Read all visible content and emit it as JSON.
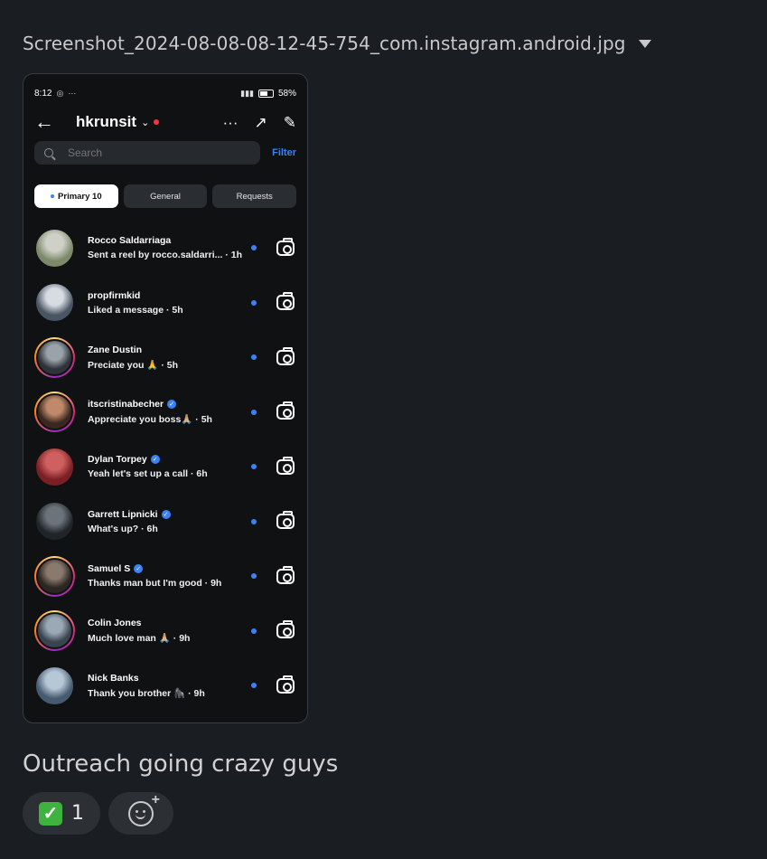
{
  "file": {
    "name": "Screenshot_2024-08-08-08-12-45-754_com.instagram.android.jpg"
  },
  "phone": {
    "status": {
      "time": "8:12",
      "dots": "···",
      "battery": "58%"
    },
    "header": {
      "username": "hkrunsit",
      "more": "···"
    },
    "search": {
      "placeholder": "Search",
      "filter_label": "Filter"
    },
    "tabs": [
      {
        "label": "Primary 10",
        "active": true
      },
      {
        "label": "General",
        "active": false
      },
      {
        "label": "Requests",
        "active": false
      }
    ],
    "threads": [
      {
        "name": "Rocco Saldarriaga",
        "verified": false,
        "message": "Sent a reel by rocco.saldarri...",
        "time": "1h",
        "ring": false,
        "avatar_colors": [
          "#cfd1c8",
          "#7d8a6a"
        ]
      },
      {
        "name": "propfirmkid",
        "verified": false,
        "message": "Liked a message",
        "time": "5h",
        "ring": false,
        "avatar_colors": [
          "#d7dbe2",
          "#4a5563"
        ]
      },
      {
        "name": "Zane Dustin",
        "verified": false,
        "message": "Preciate you 🙏",
        "time": "5h",
        "ring": true,
        "avatar_colors": [
          "#9aa2aa",
          "#2d3338"
        ]
      },
      {
        "name": "itscristinabecher",
        "verified": true,
        "message": "Appreciate you boss🙏🏼",
        "time": "5h",
        "ring": true,
        "avatar_colors": [
          "#c08a6a",
          "#3a2720"
        ]
      },
      {
        "name": "Dylan Torpey",
        "verified": true,
        "message": "Yeah let's set up a call",
        "time": "6h",
        "ring": false,
        "avatar_colors": [
          "#d06060",
          "#7a1f24"
        ]
      },
      {
        "name": "Garrett Lipnicki",
        "verified": true,
        "message": "What's up?",
        "time": "6h",
        "ring": false,
        "avatar_colors": [
          "#6c737a",
          "#1f2428"
        ]
      },
      {
        "name": "Samuel S",
        "verified": true,
        "message": "Thanks man but I'm good",
        "time": "9h",
        "ring": true,
        "avatar_colors": [
          "#8a7a6e",
          "#2b2622"
        ]
      },
      {
        "name": "Colin Jones",
        "verified": false,
        "message": "Much love man 🙏🏼",
        "time": "9h",
        "ring": true,
        "avatar_colors": [
          "#9ba8b5",
          "#39444f"
        ]
      },
      {
        "name": "Nick Banks",
        "verified": false,
        "message": "Thank you brother 🦍",
        "time": "9h",
        "ring": false,
        "avatar_colors": [
          "#b6c7d6",
          "#465b70"
        ]
      }
    ]
  },
  "message": {
    "caption": "Outreach going crazy guys"
  },
  "reactions": [
    {
      "emoji": "✅",
      "count": "1"
    }
  ],
  "colors": {
    "background": "#1a1d21",
    "accent": "#3b82f6",
    "reaction_bg": "#2c2f33"
  }
}
